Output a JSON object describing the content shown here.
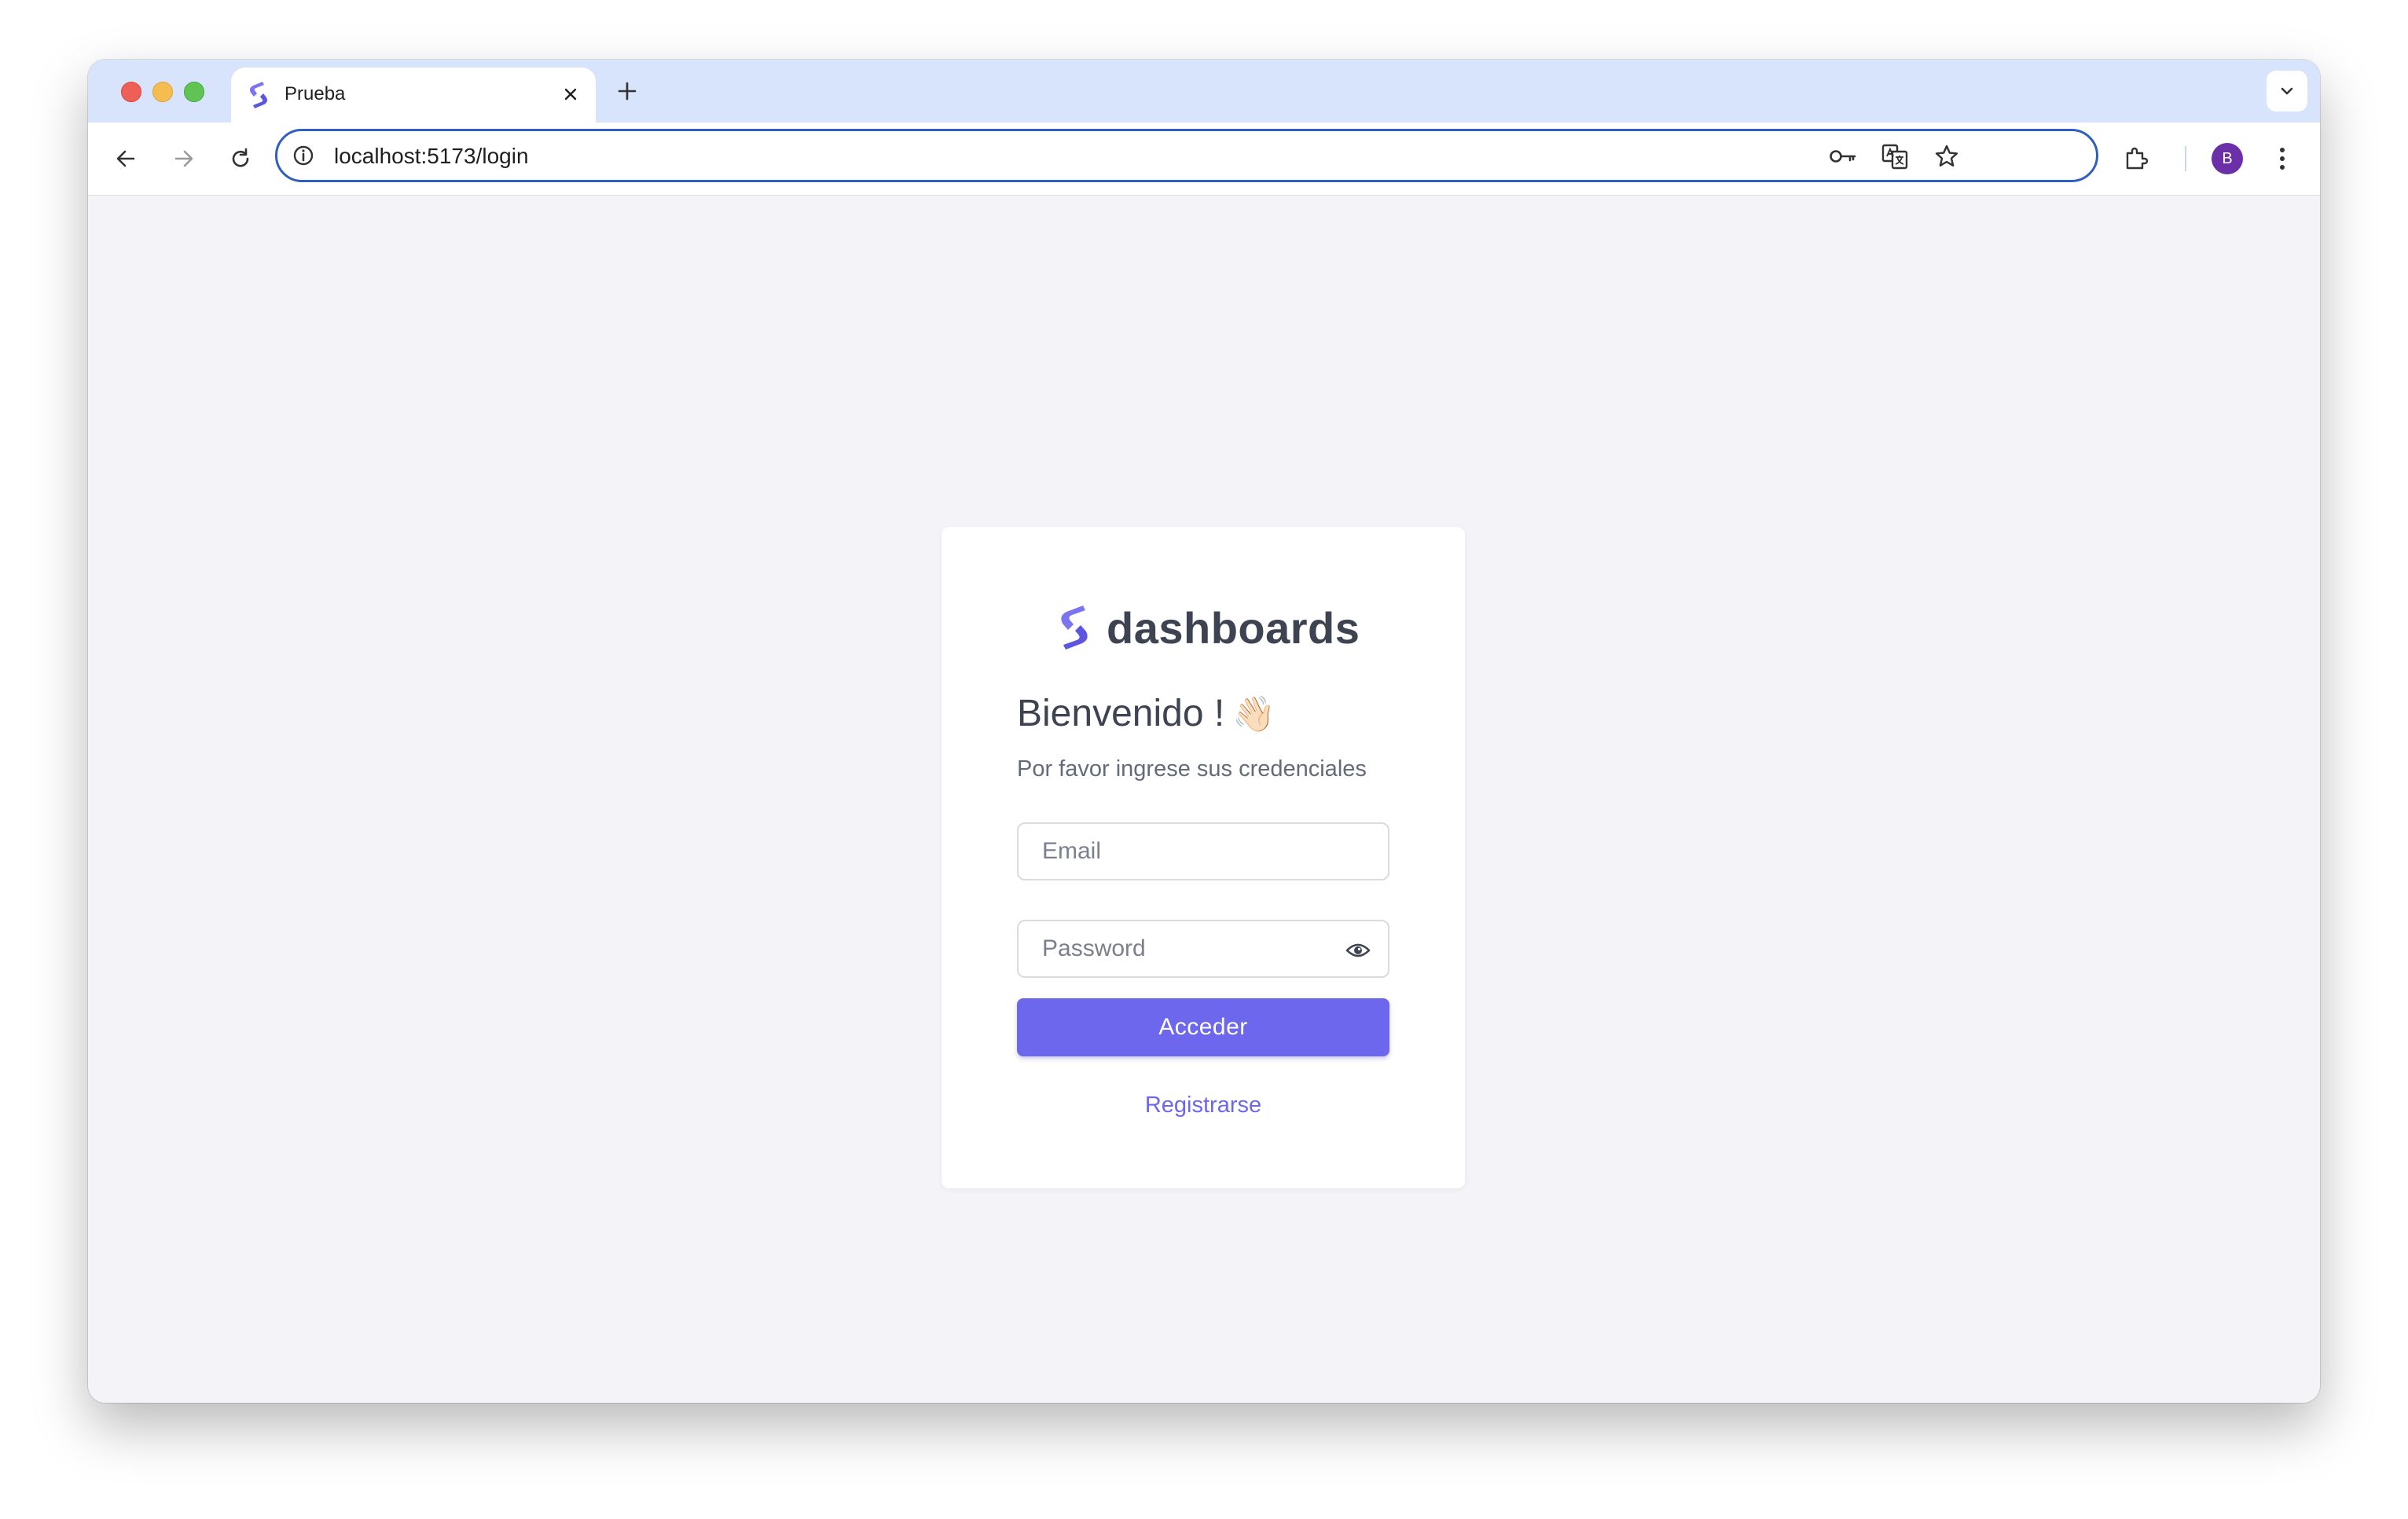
{
  "browser": {
    "tab": {
      "title": "Prueba",
      "close_icon": "close-icon",
      "favicon": "dashboards-logo"
    },
    "new_tab_label": "+",
    "address_bar": {
      "url": "localhost:5173/login"
    },
    "avatar_initial": "B",
    "icons": [
      "back-arrow-icon",
      "forward-arrow-icon",
      "reload-icon",
      "info-icon",
      "key-icon",
      "translate-icon",
      "star-icon",
      "extensions-icon",
      "more-vert-icon",
      "chevron-down-icon"
    ]
  },
  "login": {
    "brand": "dashboards",
    "welcome": "Bienvenido !",
    "wave_emoji": "👋🏻",
    "subtitle": "Por favor ingrese sus credenciales",
    "email_placeholder": "Email",
    "password_placeholder": "Password",
    "submit_label": "Acceder",
    "register_label": "Registrarse"
  },
  "colors": {
    "accent": "#6d67ee",
    "logo": "#7b75f2",
    "text": "#3d4351",
    "background": "#f4f4f8",
    "tabstrip": "#d8e4fb",
    "omnibox_border": "#2f5fc1",
    "avatar": "#6b2fa8"
  }
}
